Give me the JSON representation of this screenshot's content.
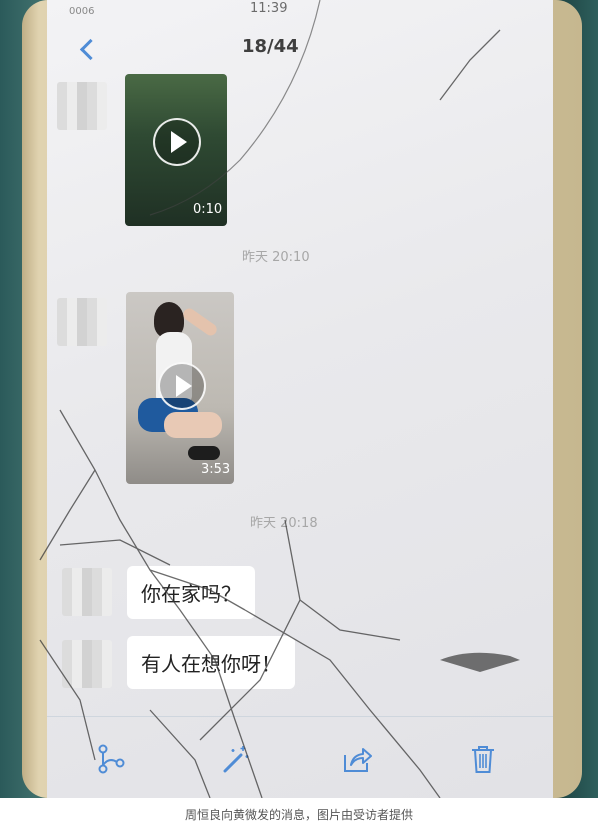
{
  "status_bar": {
    "time": "11:39",
    "carrier": "0006"
  },
  "nav": {
    "title": "18/44"
  },
  "messages": {
    "video1_duration": "0:10",
    "timestamp1": "昨天 20:10",
    "video2_duration": "3:53",
    "timestamp2": "昨天 20:18",
    "text1": "你在家吗？",
    "text2": "有人在想你呀！"
  },
  "toolbar": {
    "icons": [
      "share-branch-icon",
      "magic-wand-icon",
      "forward-icon",
      "trash-icon"
    ],
    "icon_color": "#4f8cd6"
  },
  "caption": "周恒良向黄微发的消息，图片由受访者提供"
}
